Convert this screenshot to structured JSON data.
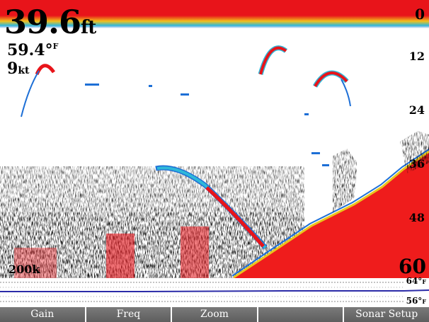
{
  "readouts": {
    "depth_value": "39.6",
    "depth_unit": "ft",
    "water_temp_value": "59.4°",
    "water_temp_unit": "F",
    "speed_value": "9",
    "speed_unit": "kt"
  },
  "depth_scale": [
    "0",
    "12",
    "24",
    "36",
    "48",
    "60"
  ],
  "frequency": "200k",
  "temp_graph": {
    "upper_label": "64°",
    "upper_unit": "F",
    "lower_label": "56°",
    "lower_unit": "F"
  },
  "softkeys": [
    "Gain",
    "Freq",
    "Zoom",
    "",
    "Sonar Setup"
  ],
  "colors": {
    "surface": "#e8141a",
    "bottom": "#ef1c1c",
    "clutter_blue": "#1d6fd6",
    "clutter_yellow": "#f0d21a",
    "softkey_bg": "#6b6b6b",
    "temp_line": "#2b2ba8"
  }
}
